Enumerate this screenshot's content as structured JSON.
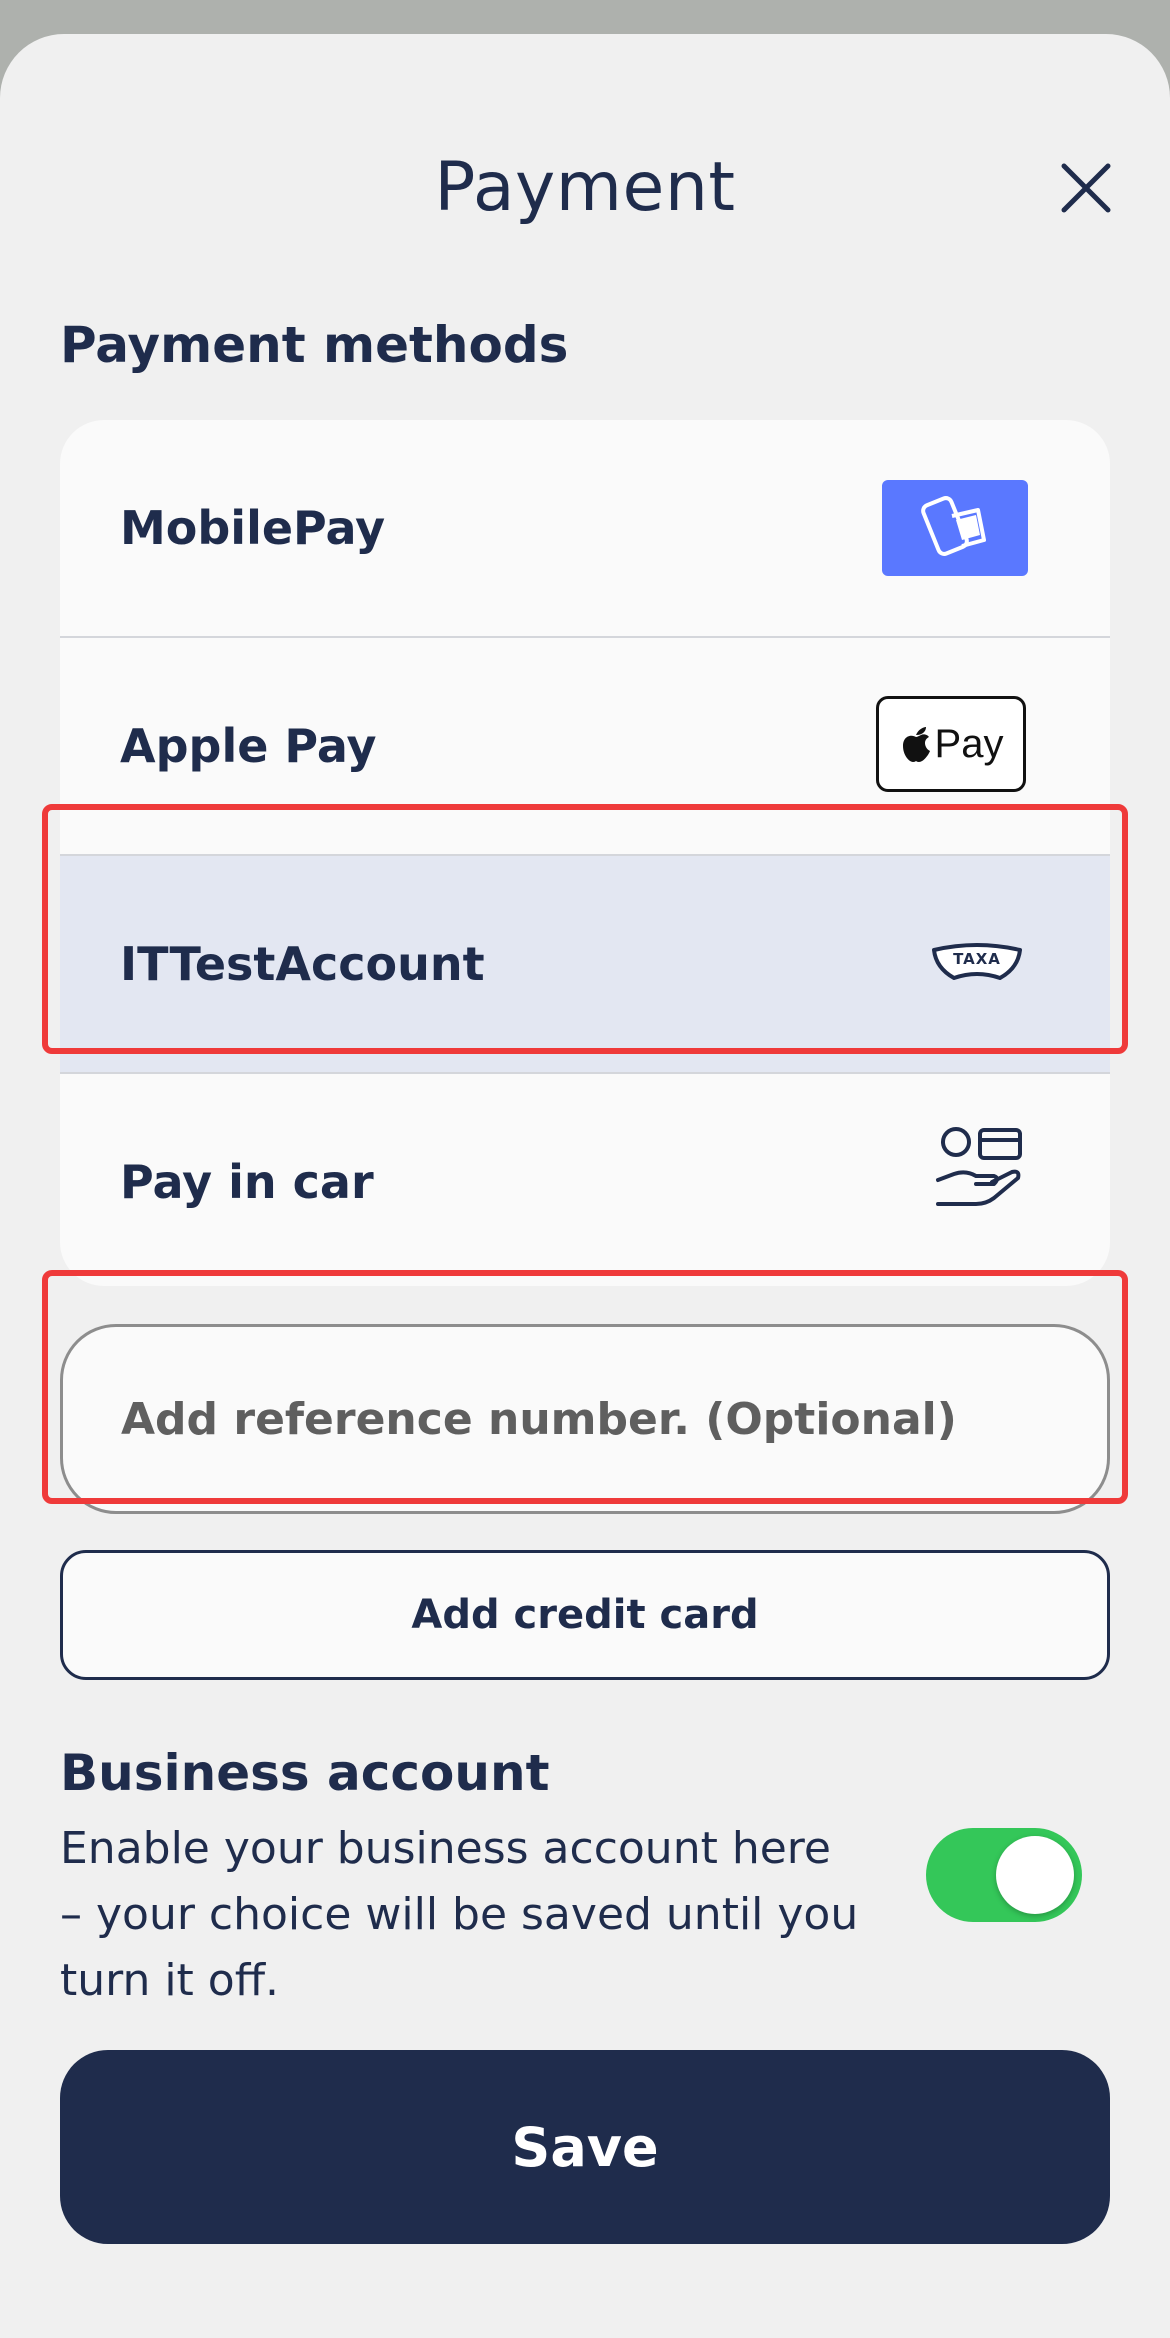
{
  "header": {
    "title": "Payment"
  },
  "payment_methods": {
    "title": "Payment methods",
    "items": [
      {
        "label": "MobilePay",
        "icon": "mobilepay-logo-icon",
        "selected": false
      },
      {
        "label": "Apple Pay",
        "icon": "apple-pay-logo-icon",
        "selected": false
      },
      {
        "label": "ITTestAccount",
        "icon": "taxa-logo-icon",
        "selected": true
      },
      {
        "label": "Pay in car",
        "icon": "pay-in-car-icon",
        "selected": false
      }
    ],
    "apple_pay_logo_text": "Pay",
    "taxa_logo_text": "TAXA"
  },
  "reference": {
    "placeholder": "Add reference number. (Optional)",
    "value": ""
  },
  "add_card": {
    "label": "Add credit card"
  },
  "business": {
    "title": "Business account",
    "description": "Enable your business account here – your choice will be saved until you turn it off.",
    "enabled": true
  },
  "save": {
    "label": "Save"
  },
  "colors": {
    "primary": "#1f2c4c",
    "mobilepay": "#5a78ff",
    "toggle_on": "#34c759",
    "highlight": "#ef3a3a",
    "selected_row": "#e3e7f2"
  }
}
